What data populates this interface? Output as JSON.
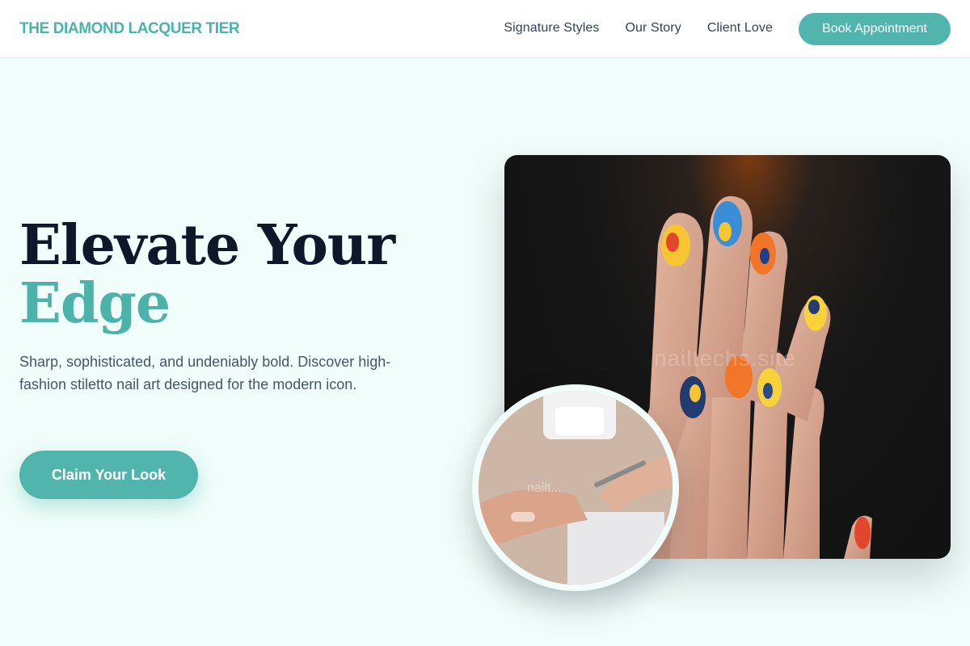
{
  "brand": {
    "name": "THE DIAMOND LACQUER TIER"
  },
  "nav": {
    "links": [
      "Signature Styles",
      "Our Story",
      "Client Love"
    ],
    "book_label": "Book Appointment"
  },
  "hero": {
    "headline_line1": "Elevate Your",
    "headline_line2": "Edge",
    "subtext": "Sharp, sophisticated, and undeniably bold. Discover high-fashion stiletto nail art designed for the modern icon.",
    "cta_label": "Claim Your Look",
    "image_watermark": "nailtechs.site",
    "circle_watermark": "nailt..."
  },
  "colors": {
    "accent": "#52b5ad",
    "background": "#f0fdfa",
    "heading": "#0f172a",
    "body_text": "#475569"
  }
}
